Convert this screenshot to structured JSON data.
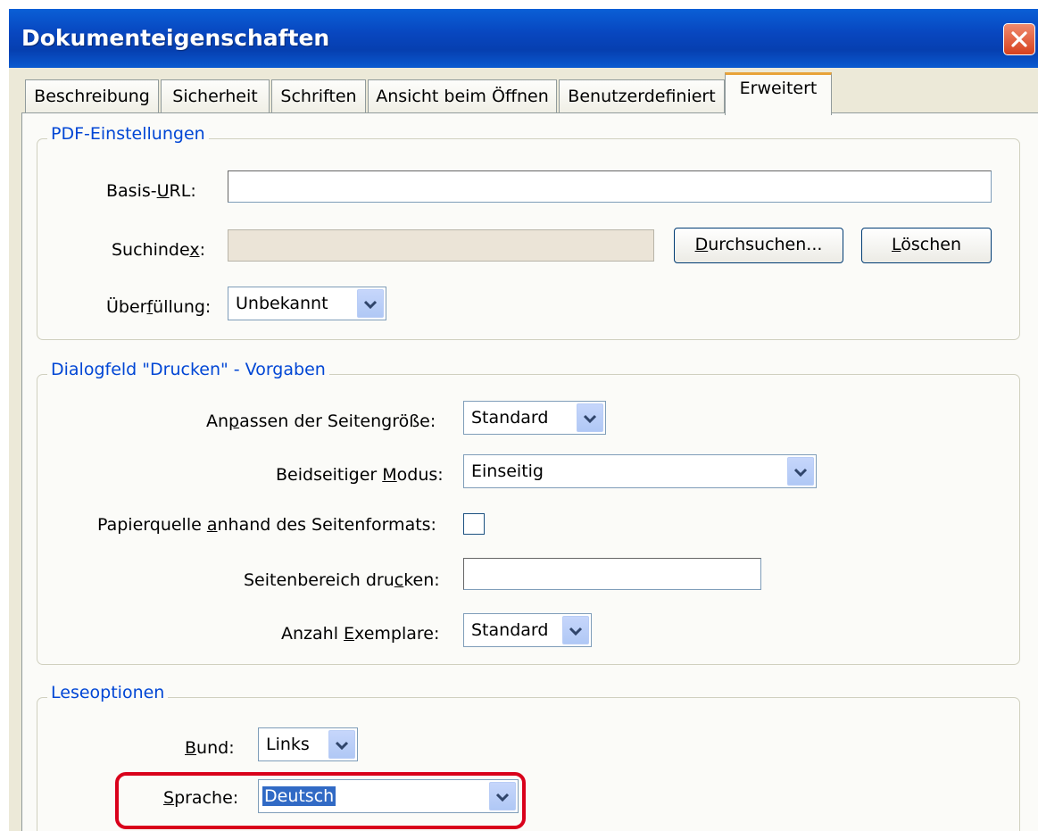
{
  "window": {
    "title": "Dokumenteigenschaften"
  },
  "tabs": [
    {
      "label": "Beschreibung"
    },
    {
      "label": "Sicherheit"
    },
    {
      "label": "Schriften"
    },
    {
      "label": "Ansicht beim Öffnen"
    },
    {
      "label": "Benutzerdefiniert"
    },
    {
      "label": "Erweitert",
      "active": true
    }
  ],
  "pdf_settings": {
    "legend": "PDF-Einstellungen",
    "base_url": {
      "label_pre": "Basis-",
      "label_u": "U",
      "label_post": "RL:",
      "value": ""
    },
    "search_index": {
      "label_pre": "Suchinde",
      "label_u": "x",
      "label_post": ":",
      "value": ""
    },
    "browse_button": {
      "label_pre": "",
      "label_u": "D",
      "label_post": "urchsuchen..."
    },
    "delete_button": {
      "label_pre": "",
      "label_u": "L",
      "label_post": "öschen"
    },
    "trapping": {
      "label_pre": "Über",
      "label_u": "f",
      "label_post": "üllung:",
      "value": "Unbekannt"
    }
  },
  "print_dialog": {
    "legend": "Dialogfeld \"Drucken\" - Vorgaben",
    "page_scaling": {
      "label_pre": "An",
      "label_u": "p",
      "label_post": "assen der Seitengröße:",
      "value": "Standard"
    },
    "duplex": {
      "label_pre": "Beidseitiger ",
      "label_u": "M",
      "label_post": "odus:",
      "value": "Einseitig"
    },
    "paper_source": {
      "label_pre": "Papierquelle ",
      "label_u": "a",
      "label_post": "nhand des Seitenformats:",
      "checked": false
    },
    "print_range": {
      "label_pre": "Seitenbereich dru",
      "label_u": "c",
      "label_post": "ken:",
      "value": ""
    },
    "copies": {
      "label_pre": "Anzahl ",
      "label_u": "E",
      "label_post": "xemplare:",
      "value": "Standard"
    }
  },
  "reading": {
    "legend": "Leseoptionen",
    "binding": {
      "label_pre": "",
      "label_u": "B",
      "label_post": "und:",
      "value": "Links"
    },
    "language": {
      "label_pre": "",
      "label_u": "S",
      "label_post": "prache:",
      "value": "Deutsch"
    }
  },
  "colors": {
    "titlebar": "#0847c0",
    "legend": "#0046d5",
    "active_tab_top": "#e8a33a",
    "highlight": "#d9001b",
    "selection": "#316ac5"
  }
}
